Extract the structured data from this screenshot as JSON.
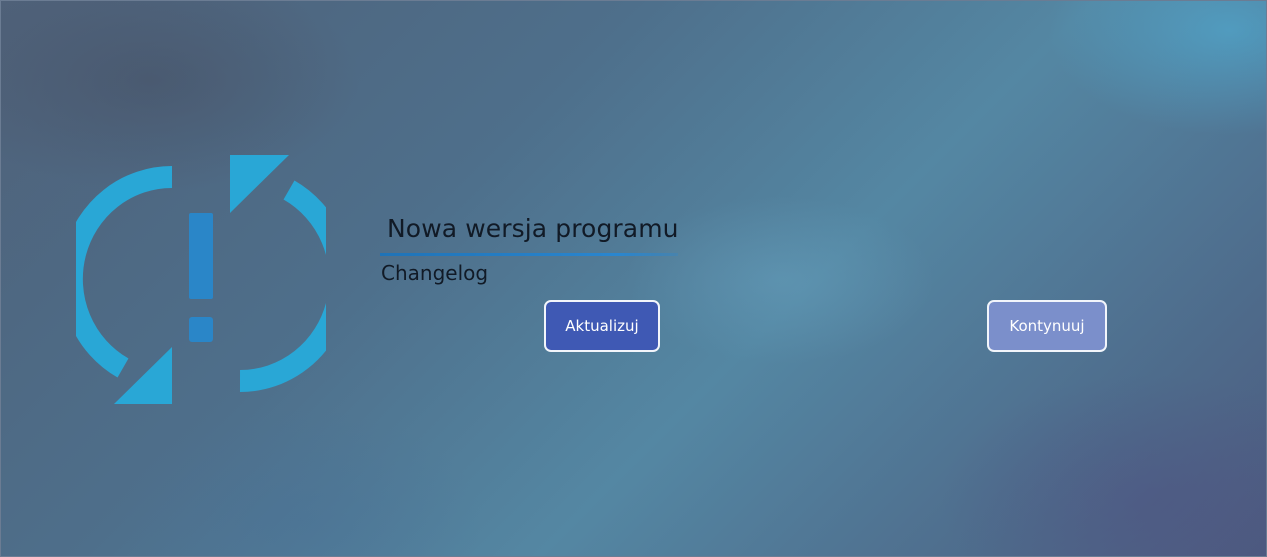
{
  "dialog": {
    "title": "Nowa wersja programu",
    "changelog_label": "Changelog",
    "update_button_label": "Aktualizuj",
    "continue_button_label": "Kontynuuj",
    "icon": "update-alert-icon"
  },
  "colors": {
    "icon_arrows": "#29a7d6",
    "icon_exclamation": "#2a86c8",
    "accent_underline": "#1f73b7",
    "update_button": "#3f59b4",
    "continue_button": "#7b8fcb",
    "text": "#111a26"
  }
}
